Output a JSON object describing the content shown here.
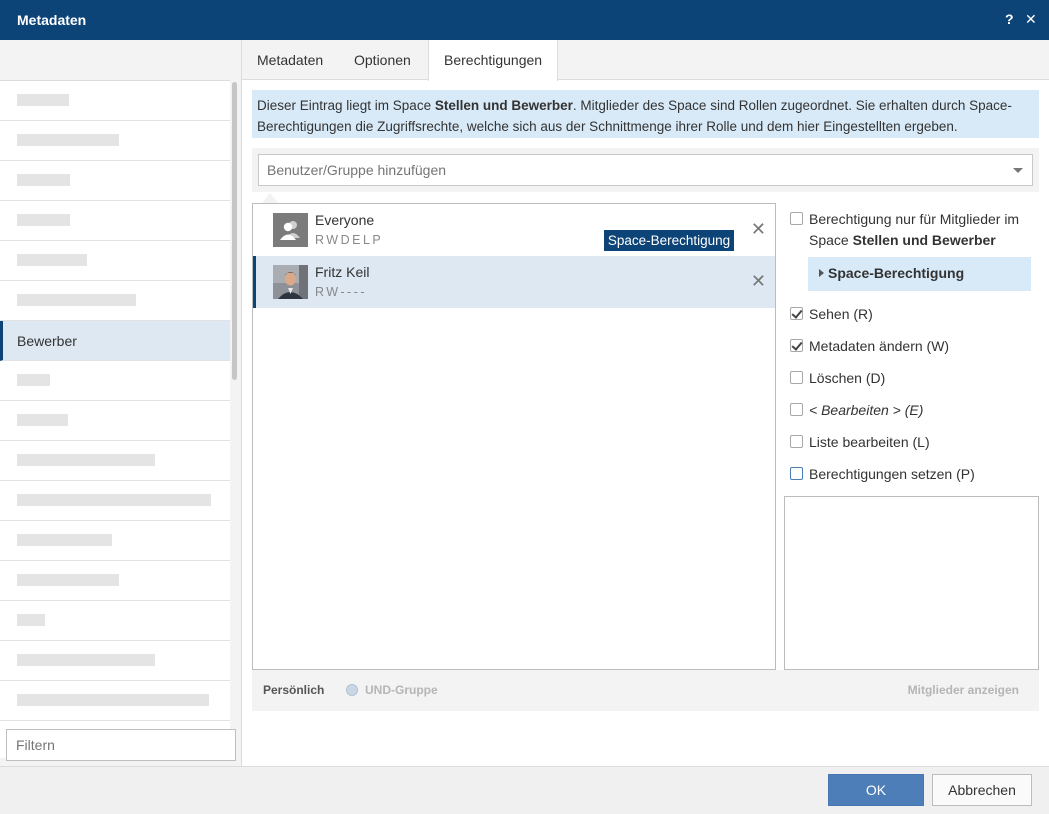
{
  "window": {
    "title": "Metadaten",
    "help_label": "?",
    "close_label": "✕"
  },
  "tabs": [
    {
      "label": "Metadaten"
    },
    {
      "label": "Optionen"
    },
    {
      "label": "Berechtigungen"
    }
  ],
  "sidebar": {
    "selected_label": "Bewerber",
    "filter_placeholder": "Filtern"
  },
  "info": {
    "text_1": "Dieser Eintrag liegt im Space ",
    "space_name": "Stellen und Bewerber",
    "text_2": ". Mitglieder des Space sind Rollen zugeordnet. Sie erhalten durch Space-Berechtigungen die Zugriffsrechte, welche sich aus der Schnittmenge ihrer Rolle und dem hier Eingestellten ergeben."
  },
  "add_user": {
    "placeholder": "Benutzer/Gruppe hinzufügen"
  },
  "entries": [
    {
      "name": "Everyone",
      "rights": "RWDELP",
      "tag": "Space-Berechtigung",
      "remove": "✕",
      "icon": "group-icon"
    },
    {
      "name": "Fritz Keil",
      "rights": "RW----",
      "remove": "✕",
      "icon": "user-photo"
    }
  ],
  "rights_panel": {
    "members_only_1": "Berechtigung nur für Mitglieder im Space ",
    "members_only_space": "Stellen und Bewerber",
    "space_expander": "Space-Berechtigung",
    "options": [
      {
        "label": "Sehen (R)",
        "checked": true
      },
      {
        "label": "Metadaten ändern (W)",
        "checked": true
      },
      {
        "label": "Löschen (D)",
        "checked": false
      },
      {
        "label": "< Bearbeiten > (E)",
        "checked": false,
        "italic": true
      },
      {
        "label": "Liste bearbeiten (L)",
        "checked": false
      },
      {
        "label": "Berechtigungen setzen (P)",
        "checked": false
      }
    ]
  },
  "legend": {
    "personal": "Persönlich",
    "und_group": "UND-Gruppe",
    "show_members": "Mitglieder anzeigen"
  },
  "footer": {
    "ok_label": "OK",
    "cancel_label": "Abbrechen"
  },
  "colors": {
    "brand": "#0d4478",
    "accent_light": "#d8eaf8",
    "ok_button": "#4e7eb8"
  }
}
